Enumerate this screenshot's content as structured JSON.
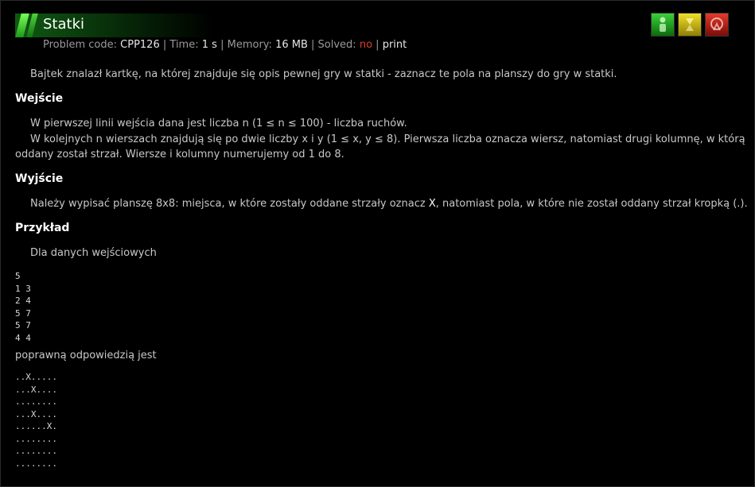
{
  "header": {
    "title": "Statki",
    "problem_code_label": "Problem code:",
    "problem_code": "CPP126",
    "time_label": "Time:",
    "time": "1 s",
    "memory_label": "Memory:",
    "memory": "16 MB",
    "solved_label": "Solved:",
    "solved": "no",
    "print_label": "print",
    "icons": [
      "green-status-icon",
      "yellow-status-icon",
      "red-status-icon"
    ]
  },
  "colors": {
    "accent": "#1d9a1a",
    "solved_no": "#e23b2b"
  },
  "content": {
    "intro": "Bajtek znalazł kartkę, na której znajduje się opis pewnej gry w statki - zaznacz te pola na planszy do gry w statki.",
    "input_heading": "Wejście",
    "input_p1": "W pierwszej linii wejścia dana jest liczba n (1 ≤ n ≤ 100) - liczba ruchów.",
    "input_p2_line1": "W kolejnych n wierszach znajdują się po dwie liczby x i y (1 ≤ x, y ≤ 8). Pierwsza liczba oznacza wiersz, natomiast drugi kolumnę, w którą",
    "input_p2_line2": "oddany został strzał. Wiersze i kolumny numerujemy od 1 do 8.",
    "output_heading": "Wyjście",
    "output_p_before": "Należy wypisać planszę 8x8: miejsca, w które zostały oddane strzały oznacz ",
    "output_p_x": "X",
    "output_p_after": ", natomiast pola, w które nie został oddany strzał kropką (.).",
    "example_heading": "Przykład",
    "example_intro": "Dla danych wejściowych",
    "example_input": "5\n1 3\n2 4\n5 7\n5 7\n4 4",
    "answer_intro": "poprawną odpowiedzią jest",
    "example_output": "..X.....\n...X....\n........\n...X....\n......X.\n........\n........\n........"
  }
}
